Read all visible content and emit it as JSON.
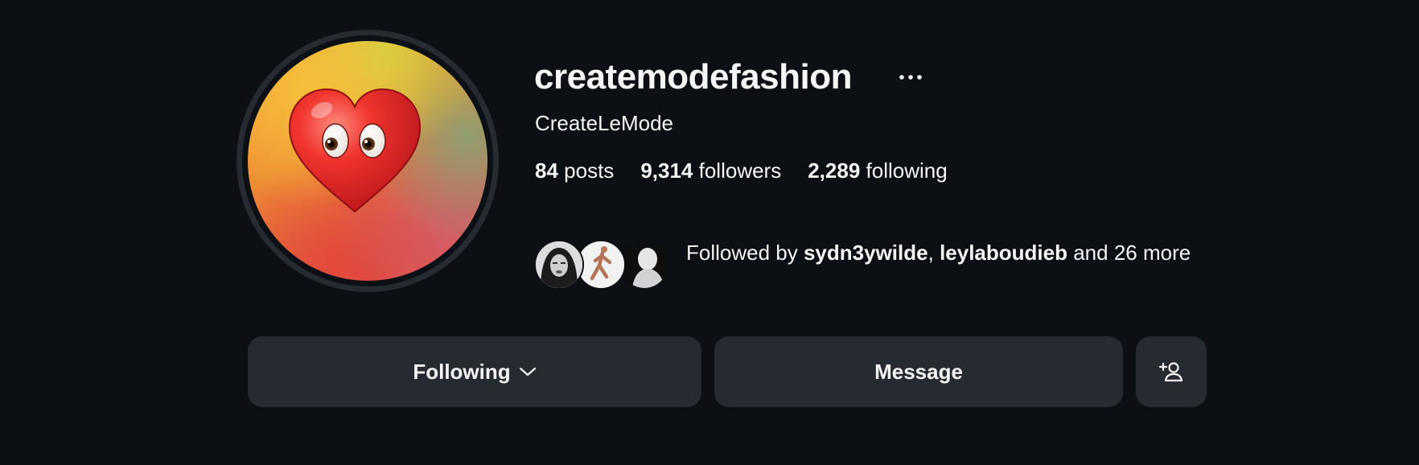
{
  "profile": {
    "username": "createmodefashion",
    "display_name": "CreateLeMode",
    "avatar_icon": "heart-with-eyes-emoji"
  },
  "stats": {
    "posts_count": "84",
    "posts_label": "posts",
    "followers_count": "9,314",
    "followers_label": "followers",
    "following_count": "2,289",
    "following_label": "following"
  },
  "followed_by": {
    "prefix": "Followed by",
    "users": [
      "sydn3ywilde",
      "leylaboudieb"
    ],
    "separator": ",",
    "suffix": "and 26 more"
  },
  "actions": {
    "following_label": "Following",
    "message_label": "Message",
    "add_user_icon": "add-user-icon",
    "more_icon": "more-options-icon"
  },
  "colors": {
    "background": "#0c0f14",
    "button": "#262a31",
    "text": "#f5f5f5"
  }
}
